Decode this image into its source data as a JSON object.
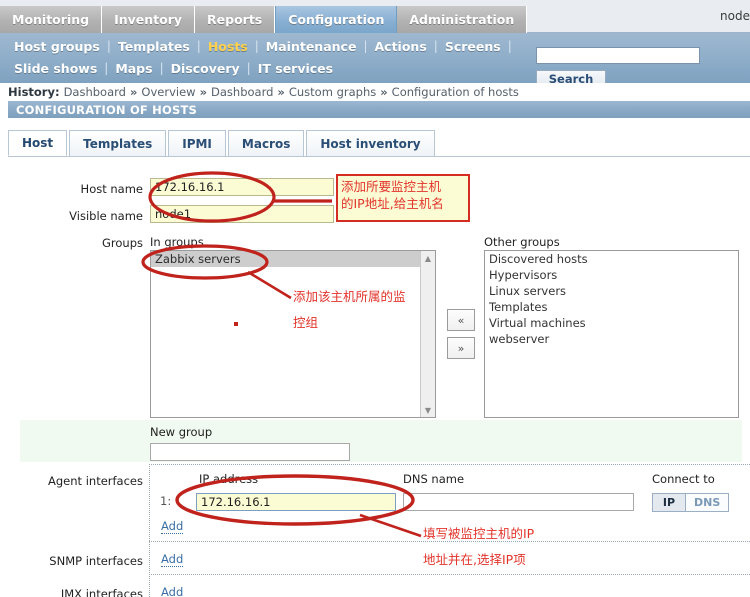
{
  "window": {
    "node_label": "node"
  },
  "topnav": {
    "items": [
      {
        "label": "Monitoring",
        "active": false
      },
      {
        "label": "Inventory",
        "active": false
      },
      {
        "label": "Reports",
        "active": false
      },
      {
        "label": "Configuration",
        "active": true
      },
      {
        "label": "Administration",
        "active": false
      }
    ]
  },
  "subnav": {
    "row1": [
      "Host groups",
      "Templates",
      "Hosts",
      "Maintenance",
      "Actions",
      "Screens"
    ],
    "row2": [
      "Slide shows",
      "Maps",
      "Discovery",
      "IT services"
    ],
    "selected": "Hosts",
    "separator": "|"
  },
  "search": {
    "value": "",
    "placeholder": "",
    "button_label": "Search"
  },
  "history": {
    "label": "History:",
    "arrow": "»",
    "crumbs": [
      "Dashboard",
      "Overview",
      "Dashboard",
      "Custom graphs",
      "Configuration of hosts"
    ]
  },
  "page": {
    "title": "CONFIGURATION OF HOSTS"
  },
  "form_tabs": [
    {
      "label": "Host",
      "active": true
    },
    {
      "label": "Templates",
      "active": false
    },
    {
      "label": "IPMI",
      "active": false
    },
    {
      "label": "Macros",
      "active": false
    },
    {
      "label": "Host inventory",
      "active": false
    }
  ],
  "form": {
    "host_name": {
      "label": "Host name",
      "value": "172.16.16.1"
    },
    "visible_name": {
      "label": "Visible name",
      "value": "node1"
    },
    "groups": {
      "label": "Groups",
      "in_groups_label": "In groups",
      "other_groups_label": "Other groups",
      "in_groups": [
        "Zabbix servers"
      ],
      "in_groups_selected": "Zabbix servers",
      "other_groups": [
        "Discovered hosts",
        "Hypervisors",
        "Linux servers",
        "Templates",
        "Virtual machines",
        "webserver"
      ],
      "move_left_label": "«",
      "move_right_label": "»"
    },
    "new_group": {
      "label": "New group",
      "value": "",
      "placeholder": ""
    },
    "agent_interfaces": {
      "label": "Agent interfaces",
      "ip_column": "IP address",
      "dns_column": "DNS name",
      "connect_column": "Connect to",
      "row_index": "1:",
      "ip_value": "172.16.16.1",
      "dns_value": "",
      "connect_ip_label": "IP",
      "connect_dns_label": "DNS",
      "connect_selected": "IP",
      "add_label": "Add"
    },
    "snmp_interfaces": {
      "label": "SNMP interfaces",
      "add_label": "Add"
    },
    "jmx_interfaces": {
      "label": "JMX interfaces",
      "add_label": "Add"
    }
  },
  "annotations": {
    "host_name_note_line1": "添加所要监控主机",
    "host_name_note_line2": "的IP地址,给主机名",
    "groups_note_line1": "添加该主机所属的监",
    "groups_note_line2": "控组",
    "ip_note_line1": "填写被监控主机的IP",
    "ip_note_line2": "地址并在,选择IP项"
  },
  "colors": {
    "accent_red": "#e03a3a",
    "annotation_red": "#e2342b",
    "nav_active_blue": "#87aed1",
    "selected_link_yellow": "#ffd24d",
    "input_yellow": "#fbfbd4",
    "new_group_band_green": "#f0faf0"
  }
}
